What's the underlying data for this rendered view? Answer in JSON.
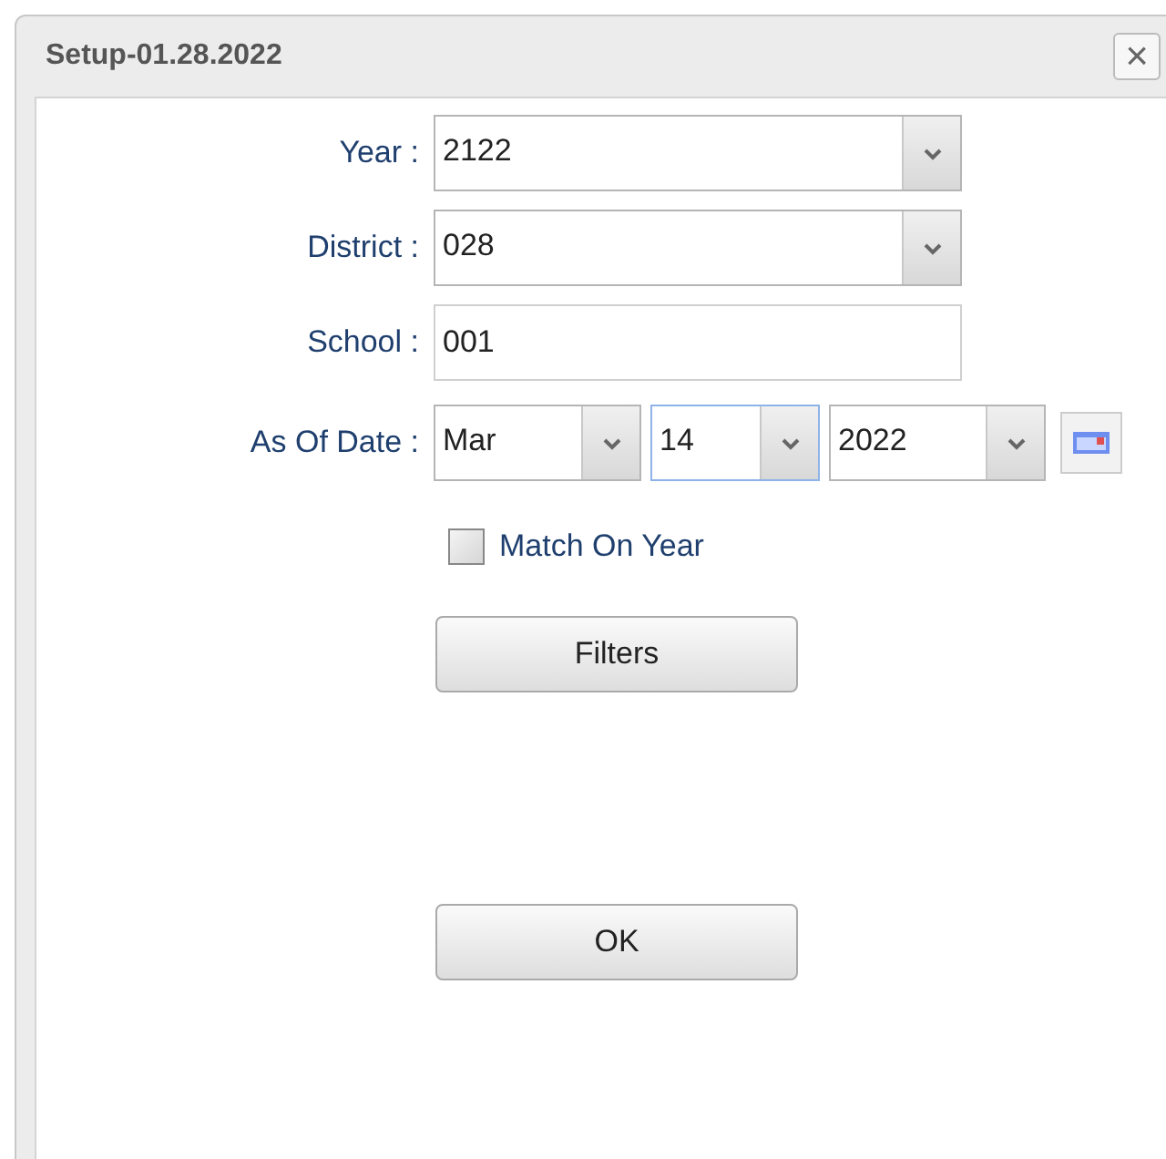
{
  "window": {
    "title": "Setup-01.28.2022",
    "close": "×"
  },
  "fields": [
    {
      "kind": "select",
      "label": "Year :",
      "value": "2122"
    },
    {
      "kind": "select",
      "label": "District :",
      "value": "028"
    },
    {
      "kind": "text",
      "label": "School :",
      "value": "001"
    }
  ],
  "as_of_date": {
    "label": "As Of Date :",
    "parts": [
      {
        "value": "Mar",
        "focused": false
      },
      {
        "value": "14",
        "focused": true
      },
      {
        "value": "2022",
        "focused": false
      }
    ]
  },
  "match_on_year": {
    "label": "Match On Year",
    "checked": false
  },
  "buttons": [
    {
      "label": "Filters"
    },
    {
      "label": "OK"
    }
  ]
}
